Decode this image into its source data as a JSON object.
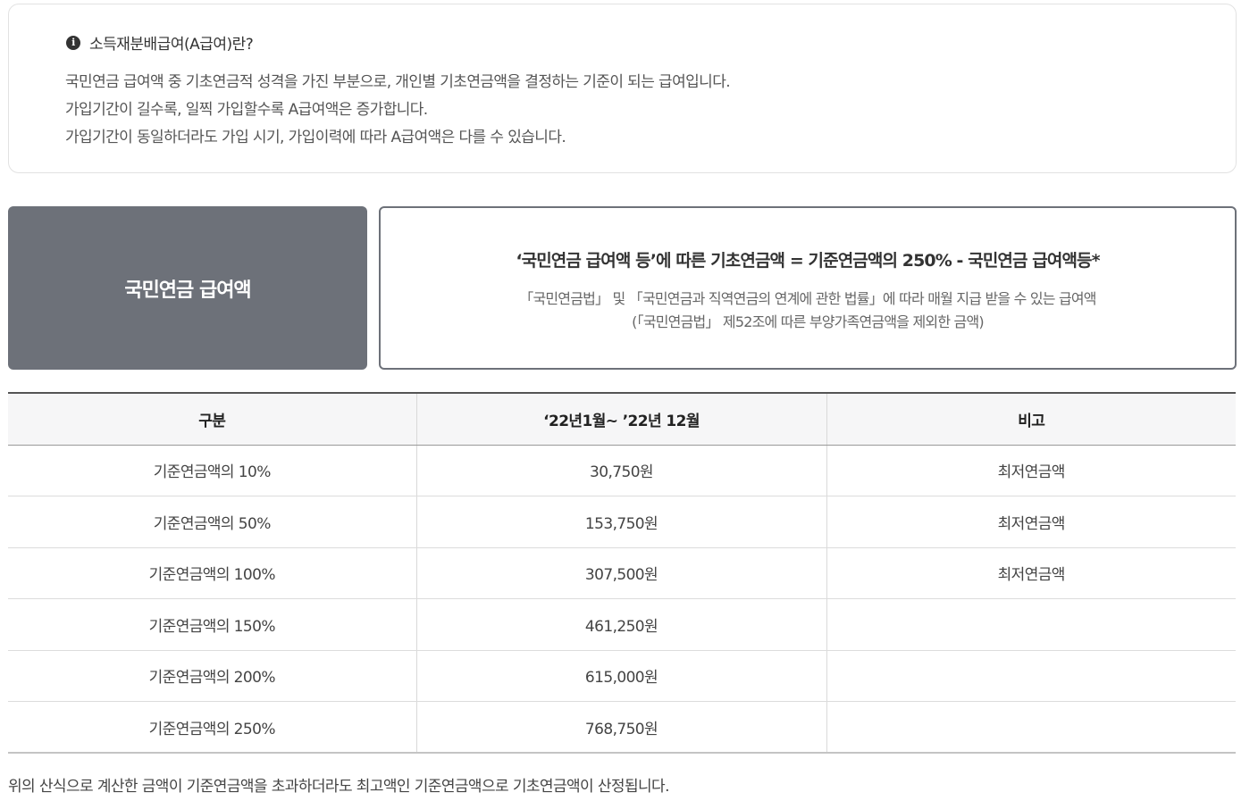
{
  "info": {
    "title": "소득재분배급여(A급여)란?",
    "lines": [
      "국민연금 급여액 중 기초연금적 성격을 가진 부분으로, 개인별 기초연금액을 결정하는 기준이 되는 급여입니다.",
      "가입기간이 길수록, 일찍 가입할수록 A급여액은 증가합니다.",
      "가입기간이 동일하더라도 가입 시기, 가입이력에 따라 A급여액은 다를 수 있습니다."
    ]
  },
  "card": {
    "label": "국민연금 급여액",
    "formula": "‘국민연금 급여액 등’에 따른 기초연금액 = 기준연금액의 250% - 국민연금 급여액등*",
    "desc1": "「국민연금법」 및 「국민연금과 직역연금의 연계에 관한 법률」에 따라 매월 지급 받을 수 있는 급여액",
    "desc2": "(「국민연금법」 제52조에 따른 부양가족연금액을 제외한 금액)"
  },
  "table": {
    "headers": [
      "구분",
      "‘22년1월~ ’22년 12월",
      "비고"
    ],
    "rows": [
      [
        "기준연금액의 10%",
        "30,750원",
        "최저연금액"
      ],
      [
        "기준연금액의 50%",
        "153,750원",
        "최저연금액"
      ],
      [
        "기준연금액의 100%",
        "307,500원",
        "최저연금액"
      ],
      [
        "기준연금액의 150%",
        "461,250원",
        ""
      ],
      [
        "기준연금액의 200%",
        "615,000원",
        ""
      ],
      [
        "기준연금액의 250%",
        "768,750원",
        ""
      ]
    ]
  },
  "footnote": "위의 산식으로 계산한 금액이 기준연금액을 초과하더라도 최고액인 기준연금액으로 기초연금액이 산정됩니다."
}
